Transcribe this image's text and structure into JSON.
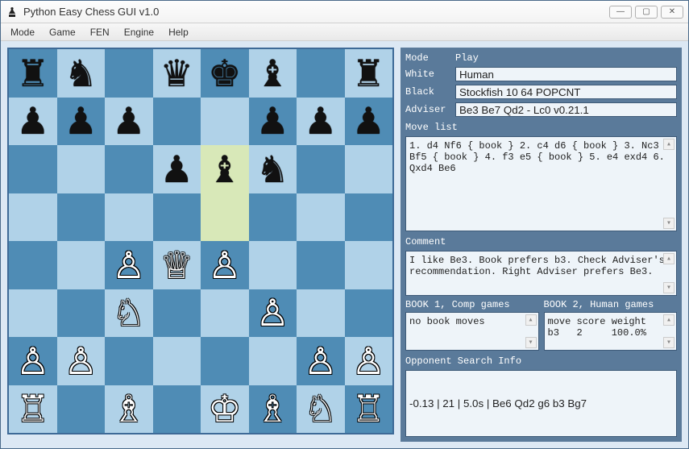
{
  "window": {
    "title": "Python Easy Chess GUI v1.0"
  },
  "menu": {
    "items": [
      "Mode",
      "Game",
      "FEN",
      "Engine",
      "Help"
    ]
  },
  "board": {
    "highlights": [
      "e6",
      "e5"
    ],
    "pieces_by_square": {
      "a8": "r",
      "b8": "n",
      "d8": "q",
      "e8": "k",
      "f8": "b",
      "h8": "r",
      "a7": "p",
      "b7": "p",
      "c7": "p",
      "f7": "p",
      "g7": "p",
      "h7": "p",
      "d6": "p",
      "e6": "b",
      "f6": "n",
      "c4": "P",
      "d4": "Q",
      "e4": "P",
      "c3": "N",
      "f3": "P",
      "a2": "P",
      "b2": "P",
      "g2": "P",
      "h2": "P",
      "a1": "R",
      "c1": "B",
      "e1": "K",
      "f1": "B",
      "g1": "N",
      "h1": "R"
    }
  },
  "panel": {
    "mode_label": "Mode",
    "mode_value": "Play",
    "white_label": "White",
    "white_value": "Human",
    "black_label": "Black",
    "black_value": "Stockfish 10 64 POPCNT",
    "adviser_label": "Adviser",
    "adviser_value": "Be3 Be7 Qd2 - Lc0 v0.21.1",
    "movelist_label": "Move list",
    "movelist_text": "1. d4 Nf6 { book } 2. c4 d6 { book } 3. Nc3 Bf5 { book } 4. f3 e5 { book } 5. e4 exd4 6. Qxd4 Be6",
    "comment_label": "Comment",
    "comment_text": "I like Be3. Book prefers b3. Check Adviser's recommendation. Right Adviser prefers Be3.",
    "book1_label": "BOOK 1, Comp games",
    "book1_text": "no book moves",
    "book2_label": "BOOK 2, Human games",
    "book2_text": "move score weight\nb3   2     100.0%",
    "search_label": "Opponent Search Info",
    "search_value": "-0.13 | 21 | 5.0s | Be6 Qd2 g6 b3 Bg7"
  }
}
